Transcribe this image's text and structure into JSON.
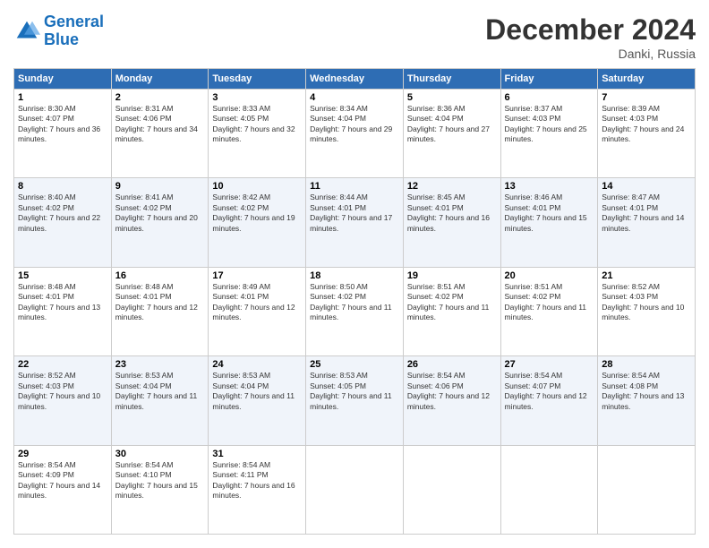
{
  "logo": {
    "line1": "General",
    "line2": "Blue"
  },
  "title": "December 2024",
  "location": "Danki, Russia",
  "days_header": [
    "Sunday",
    "Monday",
    "Tuesday",
    "Wednesday",
    "Thursday",
    "Friday",
    "Saturday"
  ],
  "weeks": [
    [
      {
        "day": "1",
        "sunrise": "8:30 AM",
        "sunset": "4:07 PM",
        "daylight": "7 hours and 36 minutes."
      },
      {
        "day": "2",
        "sunrise": "8:31 AM",
        "sunset": "4:06 PM",
        "daylight": "7 hours and 34 minutes."
      },
      {
        "day": "3",
        "sunrise": "8:33 AM",
        "sunset": "4:05 PM",
        "daylight": "7 hours and 32 minutes."
      },
      {
        "day": "4",
        "sunrise": "8:34 AM",
        "sunset": "4:04 PM",
        "daylight": "7 hours and 29 minutes."
      },
      {
        "day": "5",
        "sunrise": "8:36 AM",
        "sunset": "4:04 PM",
        "daylight": "7 hours and 27 minutes."
      },
      {
        "day": "6",
        "sunrise": "8:37 AM",
        "sunset": "4:03 PM",
        "daylight": "7 hours and 25 minutes."
      },
      {
        "day": "7",
        "sunrise": "8:39 AM",
        "sunset": "4:03 PM",
        "daylight": "7 hours and 24 minutes."
      }
    ],
    [
      {
        "day": "8",
        "sunrise": "8:40 AM",
        "sunset": "4:02 PM",
        "daylight": "7 hours and 22 minutes."
      },
      {
        "day": "9",
        "sunrise": "8:41 AM",
        "sunset": "4:02 PM",
        "daylight": "7 hours and 20 minutes."
      },
      {
        "day": "10",
        "sunrise": "8:42 AM",
        "sunset": "4:02 PM",
        "daylight": "7 hours and 19 minutes."
      },
      {
        "day": "11",
        "sunrise": "8:44 AM",
        "sunset": "4:01 PM",
        "daylight": "7 hours and 17 minutes."
      },
      {
        "day": "12",
        "sunrise": "8:45 AM",
        "sunset": "4:01 PM",
        "daylight": "7 hours and 16 minutes."
      },
      {
        "day": "13",
        "sunrise": "8:46 AM",
        "sunset": "4:01 PM",
        "daylight": "7 hours and 15 minutes."
      },
      {
        "day": "14",
        "sunrise": "8:47 AM",
        "sunset": "4:01 PM",
        "daylight": "7 hours and 14 minutes."
      }
    ],
    [
      {
        "day": "15",
        "sunrise": "8:48 AM",
        "sunset": "4:01 PM",
        "daylight": "7 hours and 13 minutes."
      },
      {
        "day": "16",
        "sunrise": "8:48 AM",
        "sunset": "4:01 PM",
        "daylight": "7 hours and 12 minutes."
      },
      {
        "day": "17",
        "sunrise": "8:49 AM",
        "sunset": "4:01 PM",
        "daylight": "7 hours and 12 minutes."
      },
      {
        "day": "18",
        "sunrise": "8:50 AM",
        "sunset": "4:02 PM",
        "daylight": "7 hours and 11 minutes."
      },
      {
        "day": "19",
        "sunrise": "8:51 AM",
        "sunset": "4:02 PM",
        "daylight": "7 hours and 11 minutes."
      },
      {
        "day": "20",
        "sunrise": "8:51 AM",
        "sunset": "4:02 PM",
        "daylight": "7 hours and 11 minutes."
      },
      {
        "day": "21",
        "sunrise": "8:52 AM",
        "sunset": "4:03 PM",
        "daylight": "7 hours and 10 minutes."
      }
    ],
    [
      {
        "day": "22",
        "sunrise": "8:52 AM",
        "sunset": "4:03 PM",
        "daylight": "7 hours and 10 minutes."
      },
      {
        "day": "23",
        "sunrise": "8:53 AM",
        "sunset": "4:04 PM",
        "daylight": "7 hours and 11 minutes."
      },
      {
        "day": "24",
        "sunrise": "8:53 AM",
        "sunset": "4:04 PM",
        "daylight": "7 hours and 11 minutes."
      },
      {
        "day": "25",
        "sunrise": "8:53 AM",
        "sunset": "4:05 PM",
        "daylight": "7 hours and 11 minutes."
      },
      {
        "day": "26",
        "sunrise": "8:54 AM",
        "sunset": "4:06 PM",
        "daylight": "7 hours and 12 minutes."
      },
      {
        "day": "27",
        "sunrise": "8:54 AM",
        "sunset": "4:07 PM",
        "daylight": "7 hours and 12 minutes."
      },
      {
        "day": "28",
        "sunrise": "8:54 AM",
        "sunset": "4:08 PM",
        "daylight": "7 hours and 13 minutes."
      }
    ],
    [
      {
        "day": "29",
        "sunrise": "8:54 AM",
        "sunset": "4:09 PM",
        "daylight": "7 hours and 14 minutes."
      },
      {
        "day": "30",
        "sunrise": "8:54 AM",
        "sunset": "4:10 PM",
        "daylight": "7 hours and 15 minutes."
      },
      {
        "day": "31",
        "sunrise": "8:54 AM",
        "sunset": "4:11 PM",
        "daylight": "7 hours and 16 minutes."
      },
      null,
      null,
      null,
      null
    ]
  ]
}
